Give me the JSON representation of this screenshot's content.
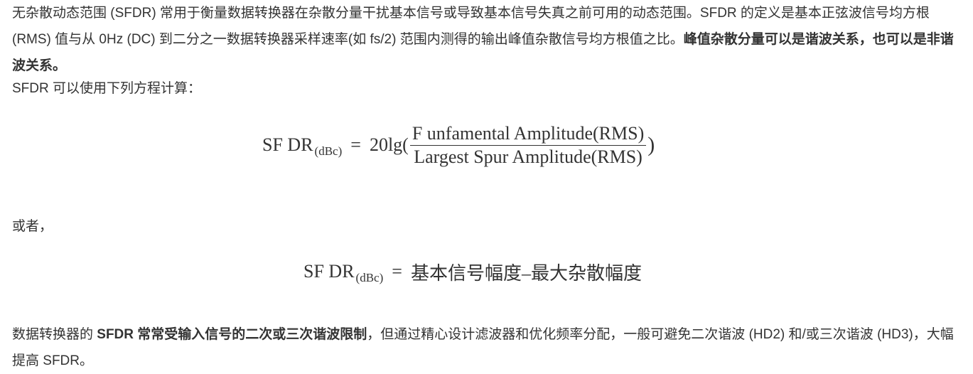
{
  "paragraph1": {
    "text_a": "无杂散动态范围 (SFDR) 常用于衡量数据转换器在杂散分量干扰基本信号或导致基本信号失真之前可用的动态范围。SFDR 的定义是基本正弦波信号均方根 (RMS) 值与从 0Hz (DC) 到二分之一数据转换器采样速率(如 fs/2) 范围内测得的输出峰值杂散信号均方根值之比。",
    "bold_a": "峰值杂散分量可以是谐波关系，也可以是非谐波关系。"
  },
  "paragraph2": {
    "text": "SFDR 可以使用下列方程计算："
  },
  "equation1": {
    "lhs": "SF DR",
    "lhs_sub": "(dBc)",
    "equals": "=",
    "func": "20lg(",
    "numerator": "F unfamental Amplitude(RMS)",
    "denominator": "Largest Spur Amplitude(RMS)",
    "close": ")"
  },
  "paragraph3": {
    "text": "或者，"
  },
  "equation2": {
    "lhs": "SF DR",
    "lhs_sub": "(dBc)",
    "equals": "=",
    "rhs": "基本信号幅度–最大杂散幅度"
  },
  "paragraph4": {
    "text_a": "数据转换器的 ",
    "bold_a": "SFDR 常常受输入信号的二次或三次谐波限制",
    "text_b": "，但通过精心设计滤波器和优化频率分配，一般可避免二次谐波 (HD2) 和/或三次谐波 (HD3)，大幅提高 SFDR。"
  }
}
